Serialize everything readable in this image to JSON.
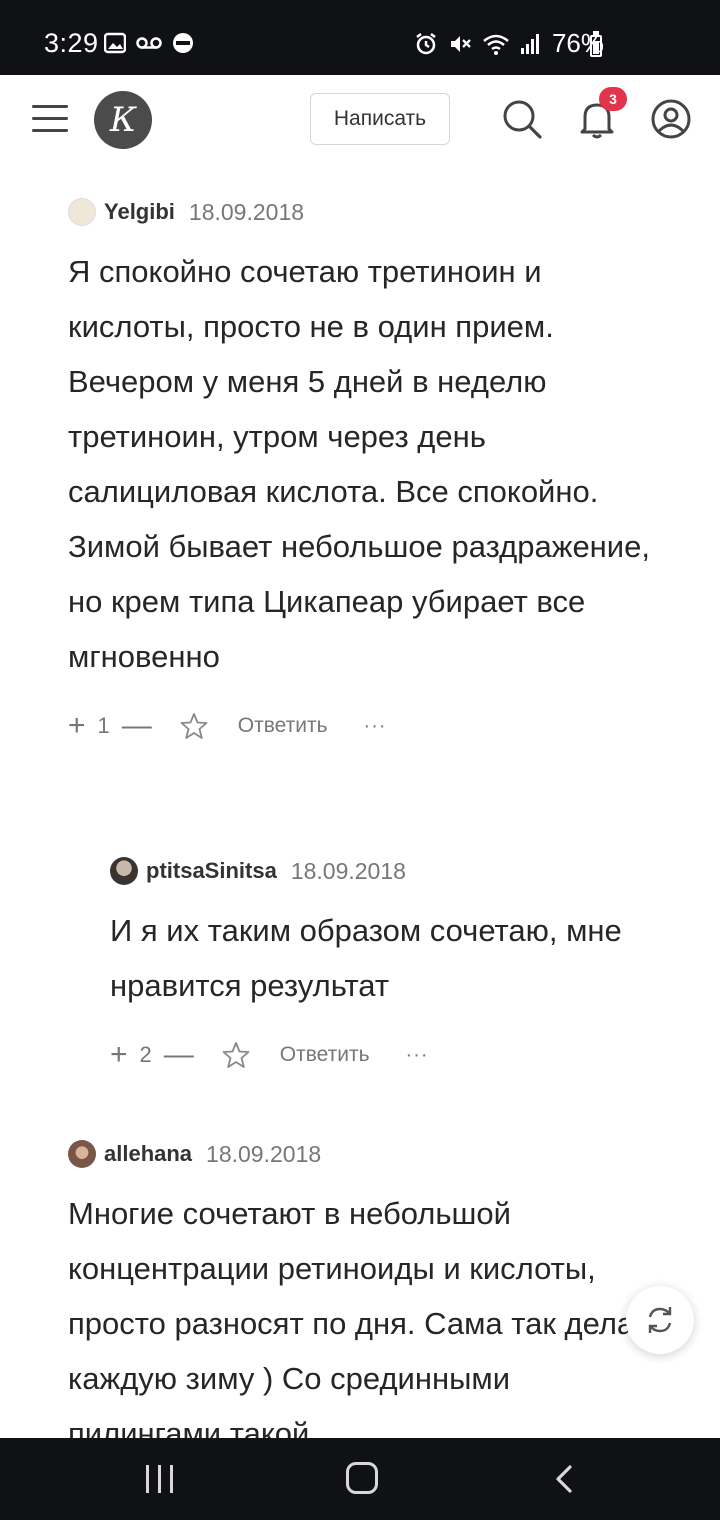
{
  "status_bar": {
    "time": "3:29",
    "battery_percent": "76%",
    "icons": [
      "gallery-icon",
      "voicemail-icon",
      "sync-icon",
      "alarm-icon",
      "mute-icon",
      "wifi-icon",
      "signal-icon",
      "battery-icon"
    ]
  },
  "header": {
    "logo_letter": "К",
    "write_label": "Написать",
    "notification_count": "3"
  },
  "comments": [
    {
      "username": "Yelgibi",
      "date": "18.09.2018",
      "text": "Я спокойно сочетаю третиноин и кислоты, просто не в один прием. Вечером у меня 5 дней в неделю третиноин, утром через день салициловая кислота. Все спокойно. Зимой бывает небольшое раздражение, но крем типа Цикапеар убирает все мгновенно",
      "rating": "1",
      "reply_label": "Ответить",
      "more_label": "···"
    },
    {
      "username": "ptitsaSinitsa",
      "date": "18.09.2018",
      "text": "И я их таким образом сочетаю, мне нравится результат",
      "rating": "2",
      "reply_label": "Ответить",
      "more_label": "···"
    },
    {
      "username": "allehana",
      "date": "18.09.2018",
      "text": "Многие сочетают в небольшой концентрации ретиноиды и кислоты, просто разносят по дня. Сама так делаю каждую зиму ) Со срединными пилингами такой"
    }
  ],
  "colors": {
    "status_bg": "#101114",
    "badge": "#e2344c",
    "text": "#262626",
    "muted": "#777777"
  }
}
